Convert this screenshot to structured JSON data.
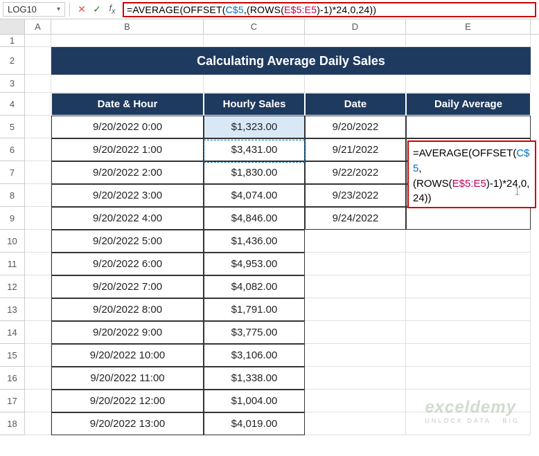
{
  "nameBox": "LOG10",
  "formula": {
    "plain": "=AVERAGE(OFFSET(C$5,(ROWS(E$5:E5)-1)*24,0,24))",
    "parts": [
      {
        "t": "=",
        "c": "f-fn"
      },
      {
        "t": "AVERAGE(OFFSET(",
        "c": "f-fn"
      },
      {
        "t": "C$5",
        "c": "f-cref"
      },
      {
        "t": ",(ROWS(",
        "c": "f-fn"
      },
      {
        "t": "E$5:E5",
        "c": "f-aref"
      },
      {
        "t": ")-1)*24,0,24))",
        "c": "f-fn"
      }
    ]
  },
  "columns": [
    "A",
    "B",
    "C",
    "D",
    "E"
  ],
  "rowNumbers": [
    1,
    2,
    3,
    4,
    5,
    6,
    7,
    8,
    9,
    10,
    11,
    12,
    13,
    14,
    15,
    16,
    17,
    18
  ],
  "title": "Calculating Average Daily Sales",
  "headers": {
    "b": "Date & Hour",
    "c": "Hourly Sales",
    "d": "Date",
    "e": "Daily Average"
  },
  "rows": [
    {
      "b": "9/20/2022 0:00",
      "c": "$1,323.00",
      "d": "9/20/2022"
    },
    {
      "b": "9/20/2022 1:00",
      "c": "$3,431.00",
      "d": "9/21/2022"
    },
    {
      "b": "9/20/2022 2:00",
      "c": "$1,830.00",
      "d": "9/22/2022"
    },
    {
      "b": "9/20/2022 3:00",
      "c": "$4,074.00",
      "d": "9/23/2022"
    },
    {
      "b": "9/20/2022 4:00",
      "c": "$4,846.00",
      "d": "9/24/2022"
    },
    {
      "b": "9/20/2022 5:00",
      "c": "$1,436.00",
      "d": ""
    },
    {
      "b": "9/20/2022 6:00",
      "c": "$4,953.00",
      "d": ""
    },
    {
      "b": "9/20/2022 7:00",
      "c": "$4,082.00",
      "d": ""
    },
    {
      "b": "9/20/2022 8:00",
      "c": "$1,791.00",
      "d": ""
    },
    {
      "b": "9/20/2022 9:00",
      "c": "$3,775.00",
      "d": ""
    },
    {
      "b": "9/20/2022 10:00",
      "c": "$3,106.00",
      "d": ""
    },
    {
      "b": "9/20/2022 11:00",
      "c": "$1,338.00",
      "d": ""
    },
    {
      "b": "9/20/2022 12:00",
      "c": "$1,004.00",
      "d": ""
    },
    {
      "b": "9/20/2022 13:00",
      "c": "$4,019.00",
      "d": ""
    }
  ],
  "watermark": {
    "big": "exceldemy",
    "small": "UNLOCK DATA · BIG"
  }
}
